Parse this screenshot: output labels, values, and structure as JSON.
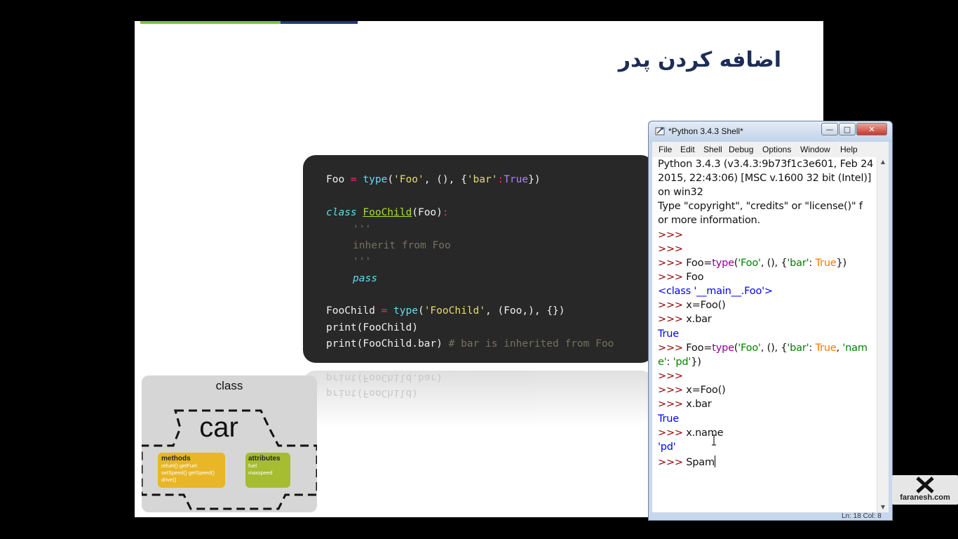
{
  "slide": {
    "title": "اضافه کردن پدر",
    "code": {
      "line1": {
        "a": "Foo ",
        "b": "=",
        "c": " ",
        "d": "type",
        "e": "(",
        "f": "'Foo'",
        "g": ", (), {",
        "h": "'bar'",
        "i": ":",
        "j": "True",
        "k": "})"
      },
      "line2": {
        "a": "class",
        "b": " ",
        "c": "FooChild",
        "d": "(Foo)",
        "e": ":"
      },
      "line3": "'''",
      "line4": "inherit from Foo",
      "line5": "'''",
      "line6": "pass",
      "line7": {
        "a": "FooChild ",
        "b": "=",
        "c": " ",
        "d": "type",
        "e": "(",
        "f": "'FooChild'",
        "g": ", (Foo,), {})"
      },
      "line8": "print(FooChild)",
      "line9": {
        "a": "print(FooChild.bar) ",
        "b": "# bar is inherited from Foo"
      }
    },
    "diagram": {
      "label": "class",
      "car": "car",
      "methods": {
        "title": "methods",
        "lines": [
          "refuel() getFuel",
          "setSpeed() getSpeed()",
          "drive()"
        ]
      },
      "attributes": {
        "title": "attributes",
        "lines": [
          "fuel",
          "maxspeed"
        ]
      }
    }
  },
  "shell": {
    "title": "*Python 3.4.3 Shell*",
    "menu": [
      "File",
      "Edit",
      "Shell",
      "Debug",
      "Options",
      "Window",
      "Help"
    ],
    "lines": {
      "l1": "Python 3.4.3 (v3.4.3:9b73f1c3e601, Feb 24",
      "l2": "2015, 22:43:06) [MSC v.1600 32 bit (Intel)]",
      "l3": "on win32",
      "l4": "Type \"copyright\", \"credits\" or \"license()\" f",
      "l5": "or more information.",
      "prompt": ">>>",
      "l8a": "Foo=",
      "l8b": "type",
      "l8c": "(",
      "l8d": "'Foo'",
      "l8e": ", (), {",
      "l8f": "'bar'",
      "l8g": ": ",
      "l8h": "True",
      "l8i": "})",
      "l9": "Foo",
      "l10": "<class '__main__.Foo'>",
      "l11": "x=Foo()",
      "l12": "x.bar",
      "l13": "True",
      "l14a": "Foo=",
      "l14b": "type",
      "l14c": "(",
      "l14d": "'Foo'",
      "l14e": ", (), {",
      "l14f": "'bar'",
      "l14g": ": ",
      "l14h": "True",
      "l14i": ", ",
      "l14j": "'nam",
      "l15a": "e'",
      "l15b": ": ",
      "l15c": "'pd'",
      "l15d": "})",
      "l17": "x=Foo()",
      "l18": "x.bar",
      "l19": "True",
      "l20": "x.name",
      "l21": "'pd'",
      "l22": "Spam"
    },
    "status": "Ln: 18 Col: 8"
  },
  "watermark": "faranesh.com"
}
